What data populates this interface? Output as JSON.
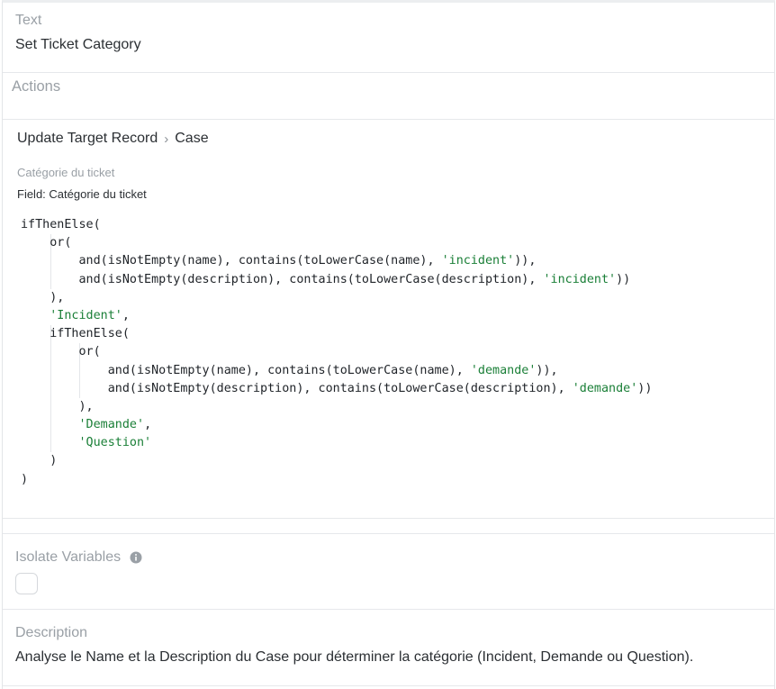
{
  "text_field": {
    "label": "Text",
    "value": "Set Ticket Category"
  },
  "actions": {
    "label": "Actions"
  },
  "action": {
    "breadcrumb": [
      "Update Target Record",
      "Case"
    ],
    "breadcrumb_separator": "›",
    "field_title": "Catégorie du ticket",
    "field_line": "Field: Catégorie du ticket",
    "code_lines": [
      [
        [
          "plain",
          "ifThenElse("
        ]
      ],
      [
        [
          "plain",
          "    or("
        ]
      ],
      [
        [
          "plain",
          "        and(isNotEmpty(name), contains(toLowerCase(name), "
        ],
        [
          "str",
          "'incident'"
        ],
        [
          "plain",
          ")),"
        ]
      ],
      [
        [
          "plain",
          "        and(isNotEmpty(description), contains(toLowerCase(description), "
        ],
        [
          "str",
          "'incident'"
        ],
        [
          "plain",
          "))"
        ]
      ],
      [
        [
          "plain",
          "    ),"
        ]
      ],
      [
        [
          "str",
          "    'Incident'"
        ],
        [
          "plain",
          ","
        ]
      ],
      [
        [
          "plain",
          "    ifThenElse("
        ]
      ],
      [
        [
          "plain",
          "        or("
        ]
      ],
      [
        [
          "plain",
          "            and(isNotEmpty(name), contains(toLowerCase(name), "
        ],
        [
          "str",
          "'demande'"
        ],
        [
          "plain",
          ")),"
        ]
      ],
      [
        [
          "plain",
          "            and(isNotEmpty(description), contains(toLowerCase(description), "
        ],
        [
          "str",
          "'demande'"
        ],
        [
          "plain",
          "))"
        ]
      ],
      [
        [
          "plain",
          "        ),"
        ]
      ],
      [
        [
          "str",
          "        'Demande'"
        ],
        [
          "plain",
          ","
        ]
      ],
      [
        [
          "str",
          "        'Question'"
        ]
      ],
      [
        [
          "plain",
          "    )"
        ]
      ],
      [
        [
          "plain",
          ")"
        ]
      ]
    ]
  },
  "isolate_variables": {
    "label": "Isolate Variables",
    "checked": false,
    "icon": "info-icon"
  },
  "description": {
    "label": "Description",
    "value": "Analyse le Name et la Description du Case pour déterminer la catégorie (Incident, Demande ou Question)."
  },
  "colors": {
    "string_literal": "#1a7f37",
    "label_gray": "#9aa0a6",
    "text": "#2b2f33",
    "border": "#e6e8eb"
  }
}
